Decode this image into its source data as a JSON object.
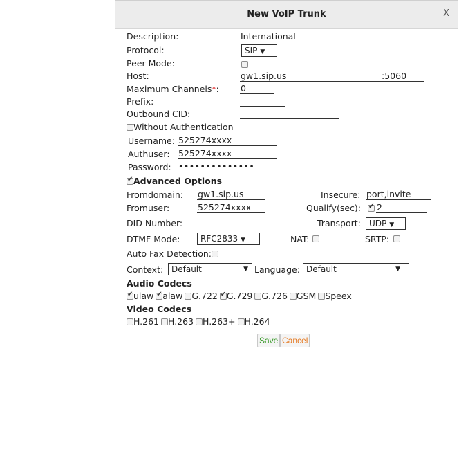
{
  "dialog": {
    "title": "New VoIP Trunk",
    "close": "X"
  },
  "labels": {
    "description": "Description:",
    "protocol": "Protocol:",
    "peer_mode": "Peer Mode:",
    "host": "Host:",
    "max_channels": "Maximum Channels",
    "max_channels_req": "*",
    "max_channels_colon": ":",
    "prefix": "Prefix:",
    "outbound_cid": "Outbound CID:",
    "without_auth": "Without Authentication",
    "username": "Username:",
    "authuser": "Authuser:",
    "password": "Password:",
    "advanced": "Advanced Options",
    "fromdomain": "Fromdomain:",
    "insecure": "Insecure:",
    "fromuser": "Fromuser:",
    "qualify": "Qualify(sec):",
    "did": "DID Number:",
    "transport": "Transport:",
    "dtmf": "DTMF Mode:",
    "nat": "NAT:",
    "srtp": "SRTP:",
    "fax": "Auto Fax Detection:",
    "context": "Context:",
    "language": "Language:",
    "audio_codecs": "Audio Codecs",
    "video_codecs": "Video Codecs"
  },
  "values": {
    "description": "International",
    "protocol": "SIP",
    "host": "gw1.sip.us",
    "port": ":5060",
    "max_channels": "0",
    "prefix": "",
    "outbound_cid": "",
    "username": "525274xxxx",
    "authuser": "525274xxxx",
    "password": "••••••••••••••",
    "fromdomain": "gw1.sip.us",
    "insecure": "port,invite",
    "fromuser": "525274xxxx",
    "qualify": "2",
    "did": "",
    "transport": "UDP",
    "dtmf": "RFC2833",
    "context": "Default",
    "language": "Default"
  },
  "audio_codecs": [
    {
      "name": "ulaw",
      "checked": true
    },
    {
      "name": "alaw",
      "checked": true
    },
    {
      "name": "G.722",
      "checked": false
    },
    {
      "name": "G.729",
      "checked": true
    },
    {
      "name": "G.726",
      "checked": false
    },
    {
      "name": "GSM",
      "checked": false
    },
    {
      "name": "Speex",
      "checked": false
    }
  ],
  "video_codecs": [
    {
      "name": "H.261",
      "checked": false
    },
    {
      "name": "H.263",
      "checked": false
    },
    {
      "name": "H.263+",
      "checked": false
    },
    {
      "name": "H.264",
      "checked": false
    }
  ],
  "buttons": {
    "save": "Save",
    "cancel": "Cancel"
  },
  "colors": {
    "required": "#e02020",
    "save": "#3a9a2a",
    "cancel": "#e67a22"
  }
}
